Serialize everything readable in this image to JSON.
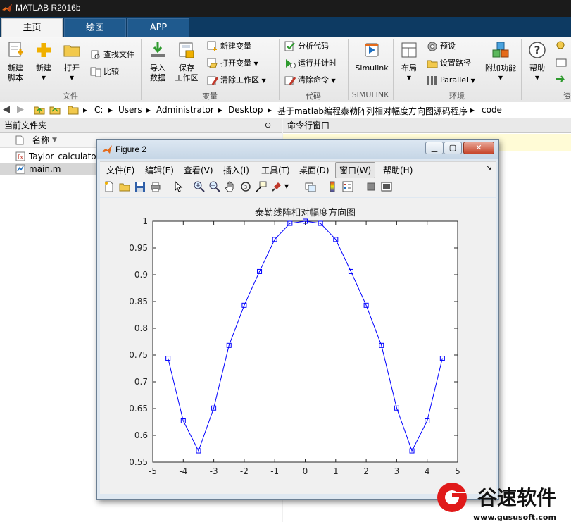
{
  "app": {
    "title": "MATLAB R2016b"
  },
  "tabs": [
    {
      "label": "主页",
      "active": true
    },
    {
      "label": "绘图",
      "active": false
    },
    {
      "label": "APP",
      "active": false
    }
  ],
  "ribbon": {
    "new_script": [
      "新建",
      "脚本"
    ],
    "new": "新建",
    "open": "打开",
    "find_files": "查找文件",
    "compare": "比较",
    "import_data": [
      "导入",
      "数据"
    ],
    "save_workspace": [
      "保存",
      "工作区"
    ],
    "new_variable": "新建变量",
    "open_variable": "打开变量",
    "clear_workspace": "清除工作区",
    "analyze_code": "分析代码",
    "run_and_time": "运行并计时",
    "clear_commands": "清除命令",
    "simulink": "Simulink",
    "layout": "布局",
    "preferences": "预设",
    "set_path": "设置路径",
    "parallel": "Parallel",
    "addons": "附加功能",
    "help": "帮助",
    "groups": {
      "file": "文件",
      "variable": "变量",
      "code": "代码",
      "simulink": "SIMULINK",
      "environment": "环境",
      "resources": "资"
    }
  },
  "address": {
    "crumbs": [
      "C:",
      "Users",
      "Administrator",
      "Desktop",
      "基于matlab编程泰勒阵列相对幅度方向图源码程序",
      "code"
    ]
  },
  "current_folder": {
    "title": "当前文件夹",
    "column_name": "名称",
    "files": [
      {
        "name": "Taylor_calculator",
        "icon": "mlx-file-icon",
        "selected": false
      },
      {
        "name": "main.m",
        "icon": "m-file-icon",
        "selected": true
      }
    ]
  },
  "command_window": {
    "title": "命令行窗口"
  },
  "figure": {
    "title": "Figure 2",
    "menu": [
      "文件(F)",
      "编辑(E)",
      "查看(V)",
      "插入(I)",
      "工具(T)",
      "桌面(D)",
      "窗口(W)",
      "帮助(H)"
    ],
    "selected_menu": "窗口(W)"
  },
  "chart_data": {
    "type": "line",
    "title": "泰勒线阵相对幅度方向图",
    "xlabel": "",
    "ylabel": "",
    "xlim": [
      -5,
      5
    ],
    "ylim": [
      0.55,
      1
    ],
    "xticks": [
      -5,
      -4,
      -3,
      -2,
      -1,
      0,
      1,
      2,
      3,
      4,
      5
    ],
    "yticks": [
      0.55,
      0.6,
      0.65,
      0.7,
      0.75,
      0.8,
      0.85,
      0.9,
      0.95,
      1
    ],
    "xtick_labels": [
      "-5",
      "-4",
      "-3",
      "-2",
      "-1",
      "0",
      "1",
      "2",
      "3",
      "4",
      "5"
    ],
    "ytick_labels": [
      "0.55",
      "0.6",
      "0.65",
      "0.7",
      "0.75",
      "0.8",
      "0.85",
      "0.9",
      "0.95",
      "1"
    ],
    "grid": false,
    "series": [
      {
        "color": "#0000ff",
        "marker": "square",
        "x": [
          -4.5,
          -4,
          -3.5,
          -3,
          -2.5,
          -2,
          -1.5,
          -1,
          -0.5,
          0,
          0.5,
          1,
          1.5,
          2,
          2.5,
          3,
          3.5,
          4,
          4.5
        ],
        "y": [
          0.744,
          0.627,
          0.571,
          0.651,
          0.768,
          0.843,
          0.906,
          0.966,
          0.996,
          1.0,
          0.996,
          0.966,
          0.906,
          0.843,
          0.768,
          0.651,
          0.571,
          0.627,
          0.744
        ]
      }
    ]
  },
  "watermark": {
    "brand": "谷速软件",
    "url": "www.gususoft.com"
  }
}
